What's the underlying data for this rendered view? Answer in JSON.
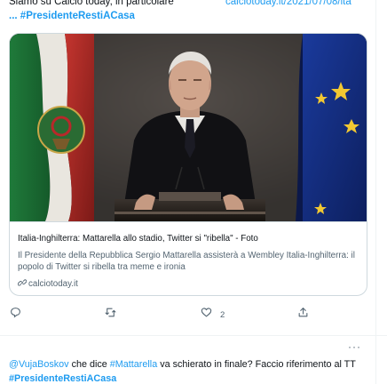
{
  "previous_tweet": {
    "line1": "Siamo su Calcio today, in particolare",
    "link": "calciotoday.it/2021/07/08/ita",
    "ellipsis": "...",
    "hashtag": "#PresidenteRestiACasa"
  },
  "card": {
    "title": "Italia-Inghilterra: Mattarella allo stadio, Twitter si \"ribella\" - Foto",
    "description": "Il Presidente della Repubblica Sergio Mattarella assisterà a Wembley Italia-Inghilterra: il popolo di Twitter si ribella tra meme e ironia",
    "domain": "calciotoday.it",
    "image_alt": "photo"
  },
  "actions": {
    "reply_icon": "reply-icon",
    "retweet_icon": "retweet-icon",
    "like_icon": "heart-icon",
    "like_count": "2",
    "share_icon": "share-icon"
  },
  "reply_tweet": {
    "mention": "@VujaBoskov",
    "text_a": " che dice ",
    "hashtag_inline": "#Mattarella",
    "text_b": " va schierato in finale? Faccio riferimento al TT ",
    "hashtag_bold": "#PresidenteRestiACasa"
  },
  "more_dots": "···",
  "colors": {
    "link": "#1d9bf0",
    "text": "#0f1419",
    "muted": "#536471",
    "border": "#cfd9de"
  }
}
